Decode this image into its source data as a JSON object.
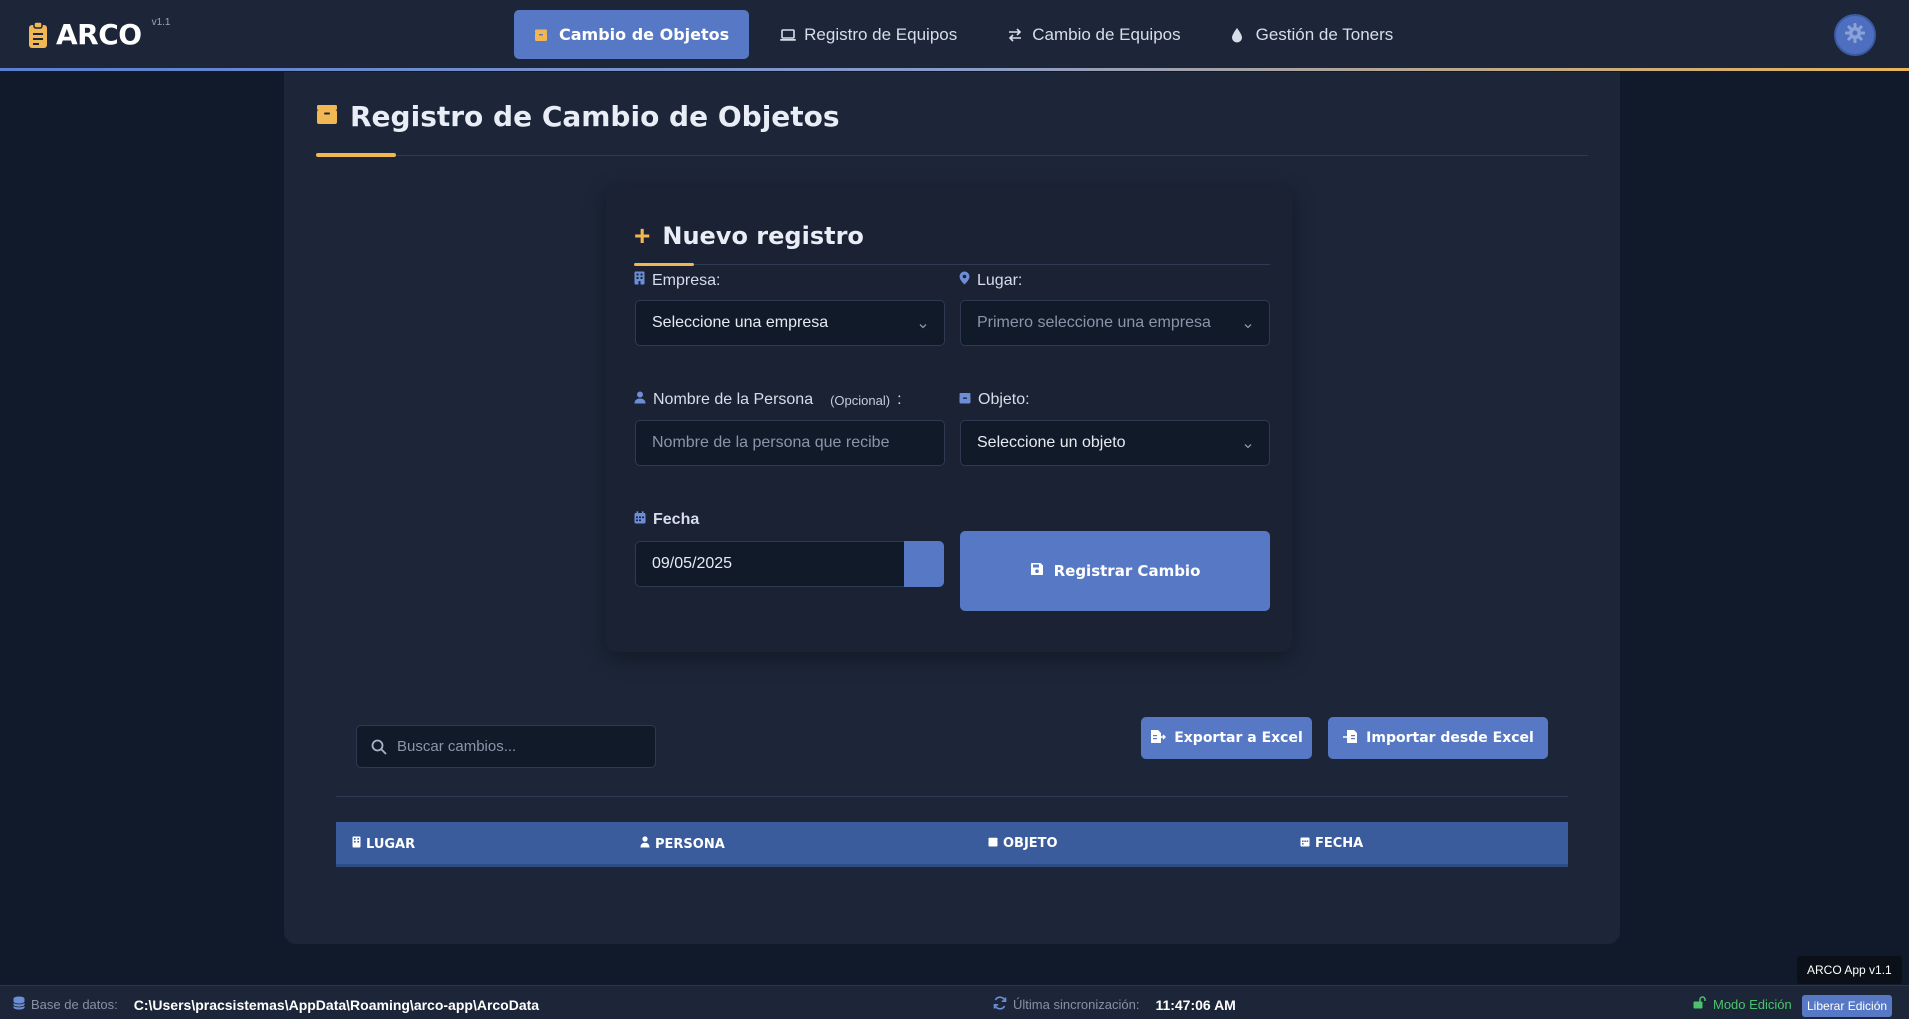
{
  "app": {
    "name": "ARCO",
    "version": "v1.1"
  },
  "nav": {
    "items": [
      {
        "label": "Cambio de Objetos",
        "icon": "box-icon",
        "active": true
      },
      {
        "label": "Registro de Equipos",
        "icon": "laptop-icon",
        "active": false
      },
      {
        "label": "Cambio de Equipos",
        "icon": "swap-arrows-icon",
        "active": false
      },
      {
        "label": "Gestión de Toners",
        "icon": "droplet-icon",
        "active": false
      }
    ],
    "settings_icon": "gear-icon"
  },
  "page": {
    "title": "Registro de Cambio de Objetos",
    "title_icon": "box-icon"
  },
  "form": {
    "title": "Nuevo registro",
    "empresa": {
      "label": "Empresa:",
      "value": "Seleccione una empresa"
    },
    "lugar": {
      "label": "Lugar:",
      "value": "Primero seleccione una empresa"
    },
    "persona": {
      "label": "Nombre de la Persona",
      "optional": "(Opcional)",
      "suffix": ":",
      "placeholder": "Nombre de la persona que recibe"
    },
    "objeto": {
      "label": "Objeto:",
      "value": "Seleccione un objeto"
    },
    "fecha": {
      "label": "Fecha",
      "value": "09/05/2025"
    },
    "submit_label": "Registrar Cambio"
  },
  "toolbar": {
    "search_placeholder": "Buscar cambios...",
    "export_label": "Exportar a Excel",
    "import_label": "Importar desde Excel"
  },
  "table": {
    "columns": [
      "LUGAR",
      "PERSONA",
      "OBJETO",
      "FECHA"
    ],
    "rows": []
  },
  "footer": {
    "db_label": "Base de datos:",
    "db_path": "C:\\Users\\pracsistemas\\AppData\\Roaming\\arco-app\\ArcoData",
    "sync_label": "Última sincronización:",
    "sync_time": "11:47:06 AM",
    "mode_label": "Modo Edición",
    "release_label": "Liberar Edición",
    "tooltip": "ARCO App v1.1"
  },
  "colors": {
    "accent_blue": "#5779c5",
    "accent_gold": "#f0b752",
    "panel": "#1c2638",
    "background": "#111a2b",
    "table_header": "#3a5c9c",
    "mode_green": "#4cc26d"
  }
}
